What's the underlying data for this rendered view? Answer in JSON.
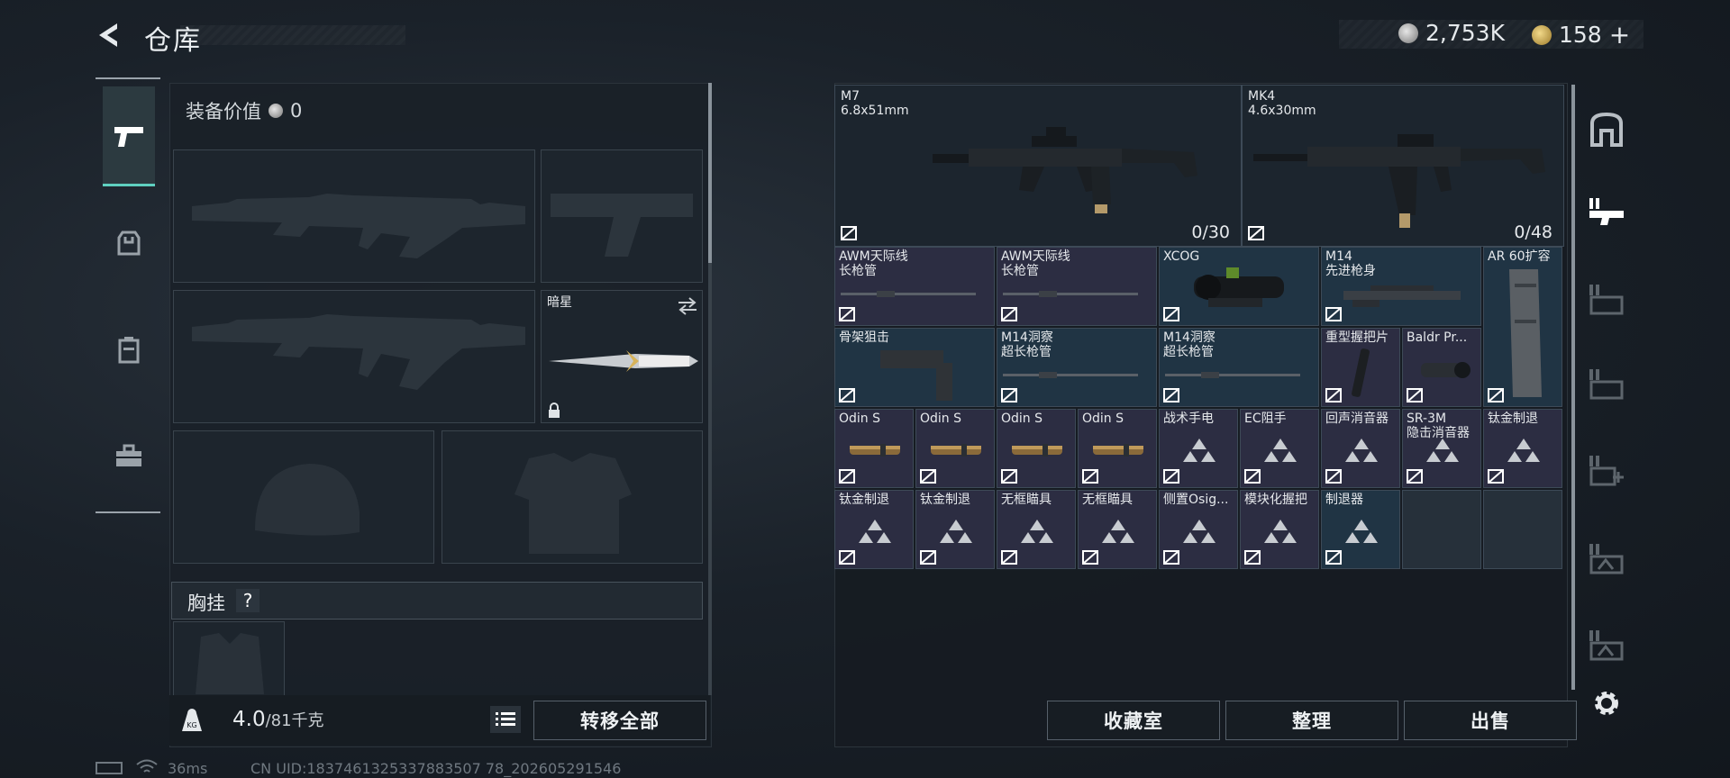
{
  "header": {
    "title": "仓库",
    "currency_silver": "2,753K",
    "currency_gold": "158",
    "plus": "+"
  },
  "left": {
    "equip_value_label": "装备价值",
    "equip_value": "0",
    "knife_name": "暗星",
    "chest_label": "胸挂",
    "chest_help": "?",
    "weight_value": "4.0",
    "weight_cap": "/81千克",
    "transfer_all": "转移全部"
  },
  "guns": [
    {
      "name": "M7",
      "caliber": "6.8x51mm",
      "ammo": "0/30"
    },
    {
      "name": "MK4",
      "caliber": "4.6x30mm",
      "ammo": "0/48"
    }
  ],
  "items": [
    {
      "l1": "AWM天际线",
      "l2": "长枪管",
      "bg": "p",
      "art": "barrel"
    },
    {
      "l1": "AWM天际线",
      "l2": "长枪管",
      "bg": "p",
      "art": "barrel"
    },
    {
      "l1": "XCOG",
      "l2": "",
      "bg": "b",
      "art": "scope"
    },
    {
      "l1": "M14",
      "l2": "先进枪身",
      "bg": "b",
      "art": "handguard"
    },
    {
      "l1": "AR 60扩容",
      "l2": "",
      "bg": "b",
      "art": "mag"
    },
    {
      "l1": "骨架狙击",
      "l2": "",
      "bg": "b",
      "art": "stock"
    },
    {
      "l1": "M14洞察",
      "l2": "超长枪管",
      "bg": "b",
      "art": "barrel"
    },
    {
      "l1": "M14洞察",
      "l2": "超长枪管",
      "bg": "b",
      "art": "barrel"
    },
    {
      "l1": "重型握把片",
      "l2": "",
      "bg": "p",
      "art": "grip"
    },
    {
      "l1": "Baldr Pr...",
      "l2": "",
      "bg": "p",
      "art": "light"
    },
    {
      "l1": "Odin S",
      "l2": "",
      "bg": "p",
      "art": "odin"
    },
    {
      "l1": "Odin S",
      "l2": "",
      "bg": "p",
      "art": "odin"
    },
    {
      "l1": "Odin S",
      "l2": "",
      "bg": "p",
      "art": "odin"
    },
    {
      "l1": "Odin S",
      "l2": "",
      "bg": "p",
      "art": "odin"
    },
    {
      "l1": "战术手电",
      "l2": "",
      "bg": "p",
      "art": "tri"
    },
    {
      "l1": "EC阻手",
      "l2": "",
      "bg": "p",
      "art": "tri"
    },
    {
      "l1": "回声消音器",
      "l2": "",
      "bg": "p",
      "art": "tri"
    },
    {
      "l1": "SR-3M",
      "l2": "隐击消音器",
      "bg": "p",
      "art": "tri"
    },
    {
      "l1": "钛金制退",
      "l2": "",
      "bg": "p",
      "art": "tri"
    },
    {
      "l1": "钛金制退",
      "l2": "",
      "bg": "p",
      "art": "tri"
    },
    {
      "l1": "钛金制退",
      "l2": "",
      "bg": "p",
      "art": "tri"
    },
    {
      "l1": "无框瞄具",
      "l2": "",
      "bg": "p",
      "art": "tri"
    },
    {
      "l1": "无框瞄具",
      "l2": "",
      "bg": "p",
      "art": "tri"
    },
    {
      "l1": "侧置Osig...",
      "l2": "",
      "bg": "p",
      "art": "tri"
    },
    {
      "l1": "模块化握把",
      "l2": "",
      "bg": "p",
      "art": "tri"
    },
    {
      "l1": "制退器",
      "l2": "",
      "bg": "b",
      "art": "tri"
    }
  ],
  "actions": {
    "collection": "收藏室",
    "sort": "整理",
    "sell": "出售"
  },
  "status": {
    "ping": "36ms",
    "uid": "CN UID:1837461325337883507 78_202605291546"
  },
  "colors": {
    "accent": "#5fd0c0",
    "purple_rarity": "#2c2d42",
    "blue_rarity": "#203444"
  }
}
